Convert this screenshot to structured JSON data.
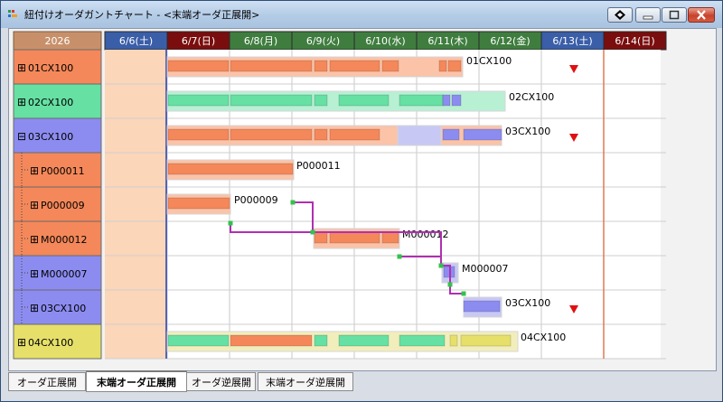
{
  "window": {
    "title": "紐付けオーダガントチャート - <末端オーダ正展開>"
  },
  "header": {
    "year": "2026",
    "days": [
      {
        "label": "6/6(土)",
        "color": "#3a5ea8"
      },
      {
        "label": "6/7(日)",
        "color": "#7a0e0e"
      },
      {
        "label": "6/8(月)",
        "color": "#3f7d3f"
      },
      {
        "label": "6/9(火)",
        "color": "#3f7d3f"
      },
      {
        "label": "6/10(水)",
        "color": "#3f7d3f"
      },
      {
        "label": "6/11(木)",
        "color": "#3f7d3f"
      },
      {
        "label": "6/12(金)",
        "color": "#3f7d3f"
      },
      {
        "label": "6/13(土)",
        "color": "#3a5ea8"
      },
      {
        "label": "6/14(日)",
        "color": "#7a0e0e"
      }
    ]
  },
  "rows": [
    {
      "label": "01CX100",
      "expander": "⊞",
      "level": 0,
      "color": "#f4885a",
      "bar_label": "01CX100",
      "marker": true
    },
    {
      "label": "02CX100",
      "expander": "⊞",
      "level": 0,
      "color": "#66e0a3",
      "bar_label": "02CX100",
      "marker": false
    },
    {
      "label": "03CX100",
      "expander": "⊟",
      "level": 0,
      "color": "#8c8cf0",
      "bar_label": "03CX100",
      "marker": true
    },
    {
      "label": "P000011",
      "expander": "⊞",
      "level": 1,
      "color": "#f4885a",
      "bar_label": "P000011",
      "marker": false
    },
    {
      "label": "P000009",
      "expander": "⊞",
      "level": 1,
      "color": "#f4885a",
      "bar_label": "P000009",
      "marker": false
    },
    {
      "label": "M000012",
      "expander": "⊞",
      "level": 1,
      "color": "#f4885a",
      "bar_label": "M000012",
      "marker": false
    },
    {
      "label": "M000007",
      "expander": "⊞",
      "level": 1,
      "color": "#8c8cf0",
      "bar_label": "M000007",
      "marker": false
    },
    {
      "label": "03CX100",
      "expander": "⊞",
      "level": 1,
      "color": "#8c8cf0",
      "bar_label": "03CX100",
      "marker": true
    },
    {
      "label": "04CX100",
      "expander": "⊞",
      "level": 0,
      "color": "#e6e06a",
      "bar_label": "04CX100",
      "marker": false
    }
  ],
  "tabs": [
    {
      "label": "オーダ正展開",
      "active": false
    },
    {
      "label": "末端オーダ正展開",
      "active": true
    },
    {
      "label": "オーダ逆展開",
      "active": false
    },
    {
      "label": "末端オーダ逆展開",
      "active": false
    }
  ],
  "colors": {
    "orange": "#f4885a",
    "green": "#66e0a3",
    "blue": "#8c8cf0",
    "yellow": "#e6e06a",
    "link": "#b02fb0",
    "marker": "#e01010",
    "past_column": "#fbd6b8"
  }
}
